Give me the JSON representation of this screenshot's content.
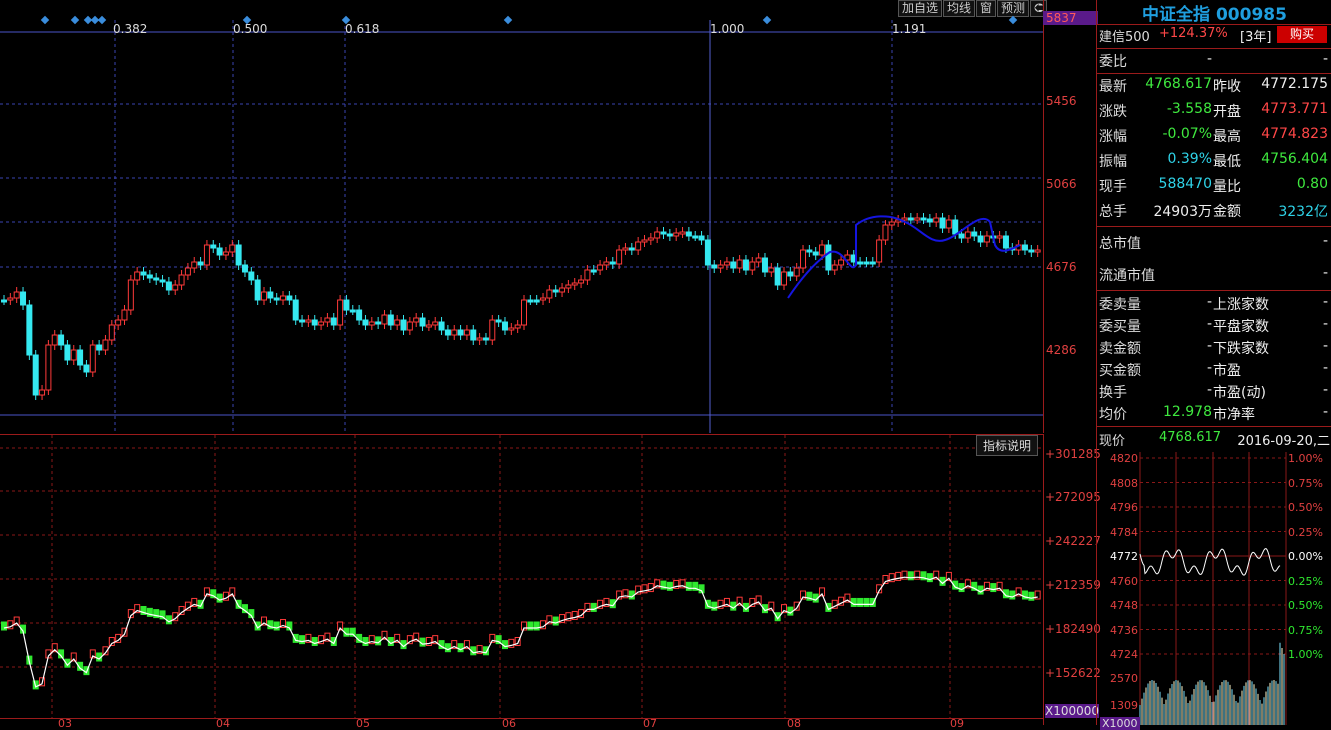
{
  "toolbar": {
    "add_watch": "加自选",
    "ma_line": "均线",
    "window": "窗",
    "forecast": "预测",
    "arrow": "⮈"
  },
  "fib": {
    "l382": "0.382",
    "l500": "0.500",
    "l618": "0.618",
    "l1000": "1.000",
    "l1191": "1.191"
  },
  "price_axis": {
    "top": "5837",
    "l1": "5456",
    "l2": "5066",
    "l3": "4676",
    "l4": "4286"
  },
  "sub_axis": {
    "l0": "+301285",
    "l1": "+272095",
    "l2": "+242227",
    "l3": "+212359",
    "l4": "+182490",
    "l5": "+152622",
    "unit": "X100000"
  },
  "indicator_btn": "指标说明",
  "months": [
    "03",
    "04",
    "05",
    "06",
    "07",
    "08",
    "09"
  ],
  "panel": {
    "title": "中证全指 000985",
    "sub_name": "建信500",
    "sub_change": "+124.37%",
    "sub_period": "[3年]",
    "buy": "购买",
    "weibi": "委比",
    "weibi_val": "-",
    "weibi_val2": "-",
    "latest_lbl": "最新",
    "latest": "4768.617",
    "prev_lbl": "昨收",
    "prev": "4772.175",
    "chg_lbl": "涨跌",
    "chg": "-3.558",
    "open_lbl": "开盘",
    "open": "4773.771",
    "pct_lbl": "涨幅",
    "pct": "-0.07%",
    "high_lbl": "最高",
    "high": "4774.823",
    "amp_lbl": "振幅",
    "amp": "0.39%",
    "low_lbl": "最低",
    "low": "4756.404",
    "hand_lbl": "现手",
    "hand": "588470",
    "ratio_lbl": "量比",
    "ratio": "0.80",
    "total_lbl": "总手",
    "total": "24903万",
    "amount_lbl": "金额",
    "amount": "3232亿",
    "mcap_lbl": "总市值",
    "mcap": "-",
    "fcap_lbl": "流通市值",
    "fcap": "-",
    "r1a": "委卖量",
    "r1b": "上涨家数",
    "r2a": "委买量",
    "r2b": "平盘家数",
    "r3a": "卖金额",
    "r3b": "下跌家数",
    "r4a": "买金额",
    "r4b": "市盈",
    "r5a": "换手",
    "r5b": "市盈(动)",
    "r6a": "均价",
    "r6a_val": "12.978",
    "r6b": "市净率",
    "dash": "-",
    "now_lbl": "现价",
    "now": "4768.617",
    "date": "2016-09-20,二"
  },
  "mini": {
    "left": [
      "4820",
      "4808",
      "4796",
      "4784",
      "4772",
      "4760",
      "4748",
      "4736",
      "4724",
      "2570",
      "1309"
    ],
    "right": [
      "1.00%",
      "0.75%",
      "0.50%",
      "0.25%",
      "0.00%",
      "0.25%",
      "0.50%",
      "0.75%",
      "1.00%"
    ],
    "bottom": "X1000"
  },
  "chart_data": {
    "type": "candlestick",
    "price_levels": [
      5837,
      5456,
      5066,
      4676,
      4286
    ],
    "fib_levels": [
      "0.382",
      "0.500",
      "0.618",
      "1.000",
      "1.191"
    ],
    "sub_levels": [
      301285,
      272095,
      242227,
      212359,
      182490,
      152622
    ]
  }
}
